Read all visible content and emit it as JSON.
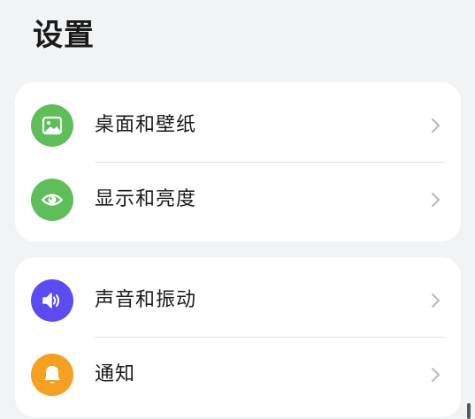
{
  "header": {
    "title": "设置"
  },
  "groups": [
    {
      "items": [
        {
          "label": "桌面和壁纸",
          "icon": "wallpaper-image-icon",
          "icon_color": "#5fbe5a"
        },
        {
          "label": "显示和亮度",
          "icon": "eye-icon",
          "icon_color": "#5fbe5a"
        }
      ]
    },
    {
      "items": [
        {
          "label": "声音和振动",
          "icon": "speaker-icon",
          "icon_color": "#5a4cf0"
        },
        {
          "label": "通知",
          "icon": "bell-icon",
          "icon_color": "#f5a020"
        }
      ]
    }
  ],
  "colors": {
    "background": "#f1f3f5",
    "card": "#ffffff",
    "chevron": "#b8b8b8"
  }
}
